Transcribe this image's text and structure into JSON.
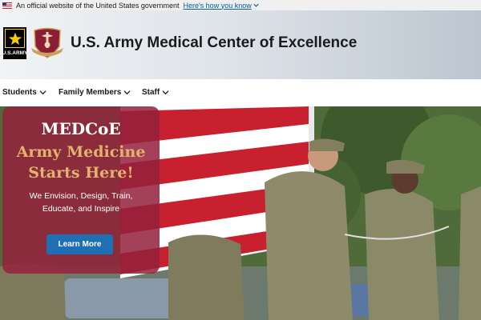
{
  "gov_banner": {
    "text": "An official website of the United States government",
    "link": "Here's how you know"
  },
  "header": {
    "logo_text": "U.S.ARMY",
    "title": "U.S. Army Medical Center of Excellence"
  },
  "nav": {
    "items": [
      {
        "label": "Students"
      },
      {
        "label": "Family Members"
      },
      {
        "label": "Staff"
      }
    ]
  },
  "hero": {
    "heading": "MEDCoE",
    "subheading": "Army Medicine Starts Here!",
    "tagline": "We Envision, Design, Train, Educate, and Inspire",
    "button_label": "Learn More"
  },
  "colors": {
    "card": "#94223d",
    "accent_gold": "#e2b26e",
    "button": "#1f6fb5",
    "link": "#005ea2"
  }
}
